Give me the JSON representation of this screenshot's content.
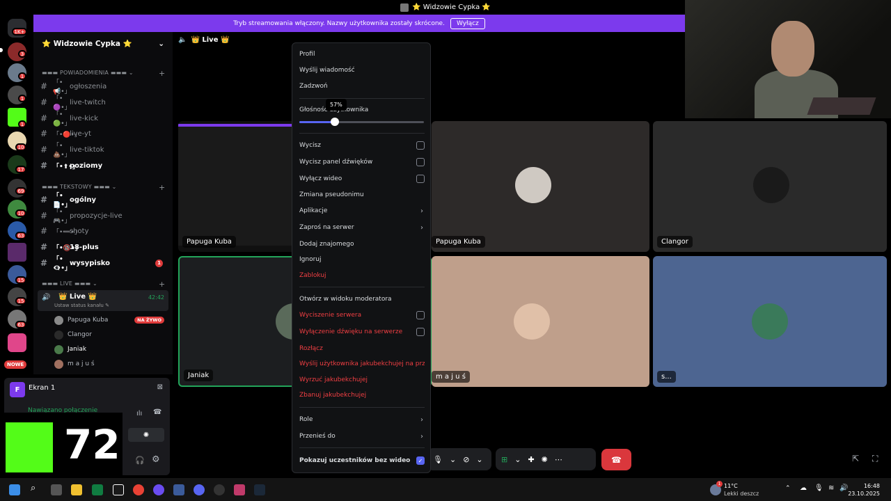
{
  "window": {
    "title": "⭐ Widzowie Cypka ⭐"
  },
  "banner": {
    "text": "Tryb streamowania włączony. Nazwy użytkownika zostały skrócone.",
    "button": "Wyłącz"
  },
  "servers": {
    "home_badge": "1K+",
    "badges": [
      "3",
      "1",
      "1",
      "1",
      "10",
      "17",
      "69",
      "10",
      "63",
      "15",
      "15",
      "63"
    ],
    "new_label": "NOWE"
  },
  "guild": {
    "name": "⭐ Widzowie Cypka ⭐"
  },
  "categories": {
    "notifications": "POWIADOMIENIA",
    "text": "TEKSTOWY",
    "live": "LIVE"
  },
  "channels": [
    {
      "name": "ogłoszenia",
      "prefix": "「•📢•」",
      "bold": false
    },
    {
      "name": "live-twitch",
      "prefix": "「•🟣•」",
      "bold": false
    },
    {
      "name": "live-kick",
      "prefix": "「•🟢•」",
      "bold": false
    },
    {
      "name": "live-yt",
      "prefix": "「•🔴•」",
      "bold": false
    },
    {
      "name": "live-tiktok",
      "prefix": "「•💩•」",
      "bold": false
    },
    {
      "name": "poziomy",
      "prefix": "「•⬆•」",
      "bold": true
    },
    {
      "name": "ogólny",
      "prefix": "「•📄•」",
      "bold": true
    },
    {
      "name": "propozycje-live",
      "prefix": "「•🎮•」",
      "bold": false
    },
    {
      "name": "shoty",
      "prefix": "「•➖•」",
      "bold": false
    },
    {
      "name": "18-plus",
      "prefix": "「•🔞•」",
      "bold": true
    },
    {
      "name": "wysypisko",
      "prefix": "「•👁‍🗨•」",
      "bold": true,
      "badge": "1"
    }
  ],
  "voice": {
    "channel": "👑 Live 👑",
    "status_hint": "Ustaw status kanału ✎",
    "timer": "42:42",
    "users": [
      {
        "name": "Papuga Kuba",
        "live": "NA ŻYWO"
      },
      {
        "name": "Clangor"
      },
      {
        "name": "Janiak"
      },
      {
        "name": "m a j u ś"
      }
    ]
  },
  "screen_panel": {
    "title": "Ekran 1",
    "initial": "F",
    "status": "Nawiązano połączenie"
  },
  "overlay": {
    "number": "72"
  },
  "stage": {
    "title": "👑 Live 👑",
    "tiles": [
      {
        "label": "Papuga Kuba"
      },
      {
        "label": "Papuga Kuba"
      },
      {
        "label": "Clangor"
      },
      {
        "label": "Janiak"
      },
      {
        "label": "m a j u ś"
      },
      {
        "label": "s..."
      }
    ]
  },
  "context_menu": {
    "items_top": [
      "Profil",
      "Wyślij wiadomość",
      "Zadzwoń"
    ],
    "volume_label": "Głośność użytkownika",
    "volume": 57,
    "volume_text": "57%",
    "checks": [
      {
        "label": "Wycisz",
        "checked": false
      },
      {
        "label": "Wycisz panel dźwięków",
        "checked": false
      },
      {
        "label": "Wyłącz wideo",
        "checked": false
      }
    ],
    "items_mid": [
      "Zmiana pseudonimu"
    ],
    "submenus": [
      "Aplikacje",
      "Zaproś na serwer"
    ],
    "items_mid2": [
      "Dodaj znajomego",
      "Ignoruj"
    ],
    "block": "Zablokuj",
    "moderator_view": "Otwórz w widoku moderatora",
    "mod_checks": [
      {
        "label": "Wyciszenie serwera",
        "checked": false
      },
      {
        "label": "Wyłączenie dźwięku na serwerze",
        "checked": false
      }
    ],
    "mod_actions": [
      "Rozłącz",
      "Wyślij użytkownika jakubekchujej na przerwę",
      "Wyrzuć jakubekchujej",
      "Zbanuj jakubekchujej"
    ],
    "submenus2": [
      "Role",
      "Przenieś do"
    ],
    "show_no_video": {
      "label": "Pokazuj uczestników bez wideo",
      "checked": true
    }
  },
  "taskbar": {
    "weather_temp": "11°C",
    "weather_desc": "Lekki deszcz",
    "weather_badge": "1",
    "time": "16:48",
    "date": "23.10.2025"
  },
  "colors": {
    "accent": "#5865f2",
    "banner": "#7c3aed",
    "danger": "#f23f43",
    "online": "#23a55a",
    "kick": "#53fc18"
  }
}
